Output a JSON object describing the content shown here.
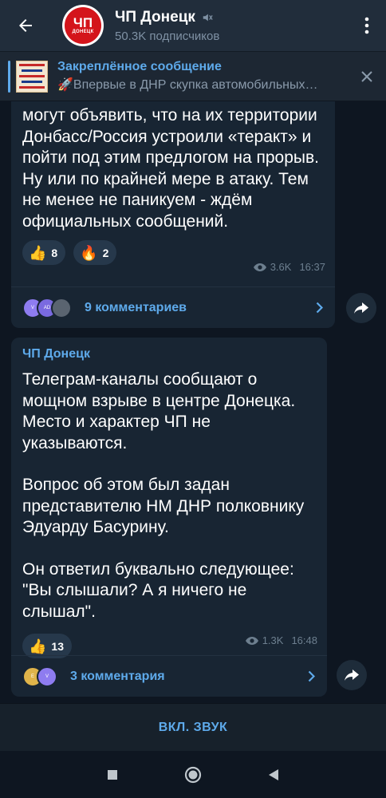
{
  "header": {
    "channel_title": "ЧП Донецк",
    "subscribers": "50.3K подписчиков",
    "avatar_big": "ЧП",
    "avatar_small": "ДОНЕЦК"
  },
  "pinned": {
    "title": "Закреплённое сообщение",
    "message": "🚀Впервые в ДНР скупка автомобильных…"
  },
  "messages": [
    {
      "text": "могут объявить, что на их территории Донбасс/Россия устроили «теракт» и пойти под этим предлогом на прорыв. Ну или по крайней мере в атаку. Тем не менее не паникуем - ждём официальных сообщений.",
      "reactions": [
        {
          "emoji": "👍",
          "count": "8"
        },
        {
          "emoji": "🔥",
          "count": "2"
        }
      ],
      "views": "3.6K",
      "time": "16:37",
      "comments": "9 комментариев",
      "comment_avatars": [
        "V",
        "AD",
        ""
      ]
    },
    {
      "sender": "ЧП Донецк",
      "paragraphs": [
        "Телеграм-каналы сообщают о мощном взрыве в центре Донецка. Место и характер ЧП не указываются.",
        "Вопрос об этом был задан представителю НМ ДНР полковнику Эдуарду Басурину.",
        "Он ответил буквально следующее: \"Вы слышали? А я ничего не слышал\"."
      ],
      "reactions": [
        {
          "emoji": "👍",
          "count": "13"
        }
      ],
      "views": "1.3K",
      "time": "16:48",
      "comments": "3 комментария",
      "comment_avatars": [
        "E",
        "V"
      ]
    }
  ],
  "bottom": {
    "sound_button": "ВКЛ. ЗВУК"
  },
  "colors": {
    "accent": "#5eaaeb",
    "header_bg": "#212d3b",
    "bubble_bg": "#182533",
    "chat_bg": "#0e1621"
  }
}
